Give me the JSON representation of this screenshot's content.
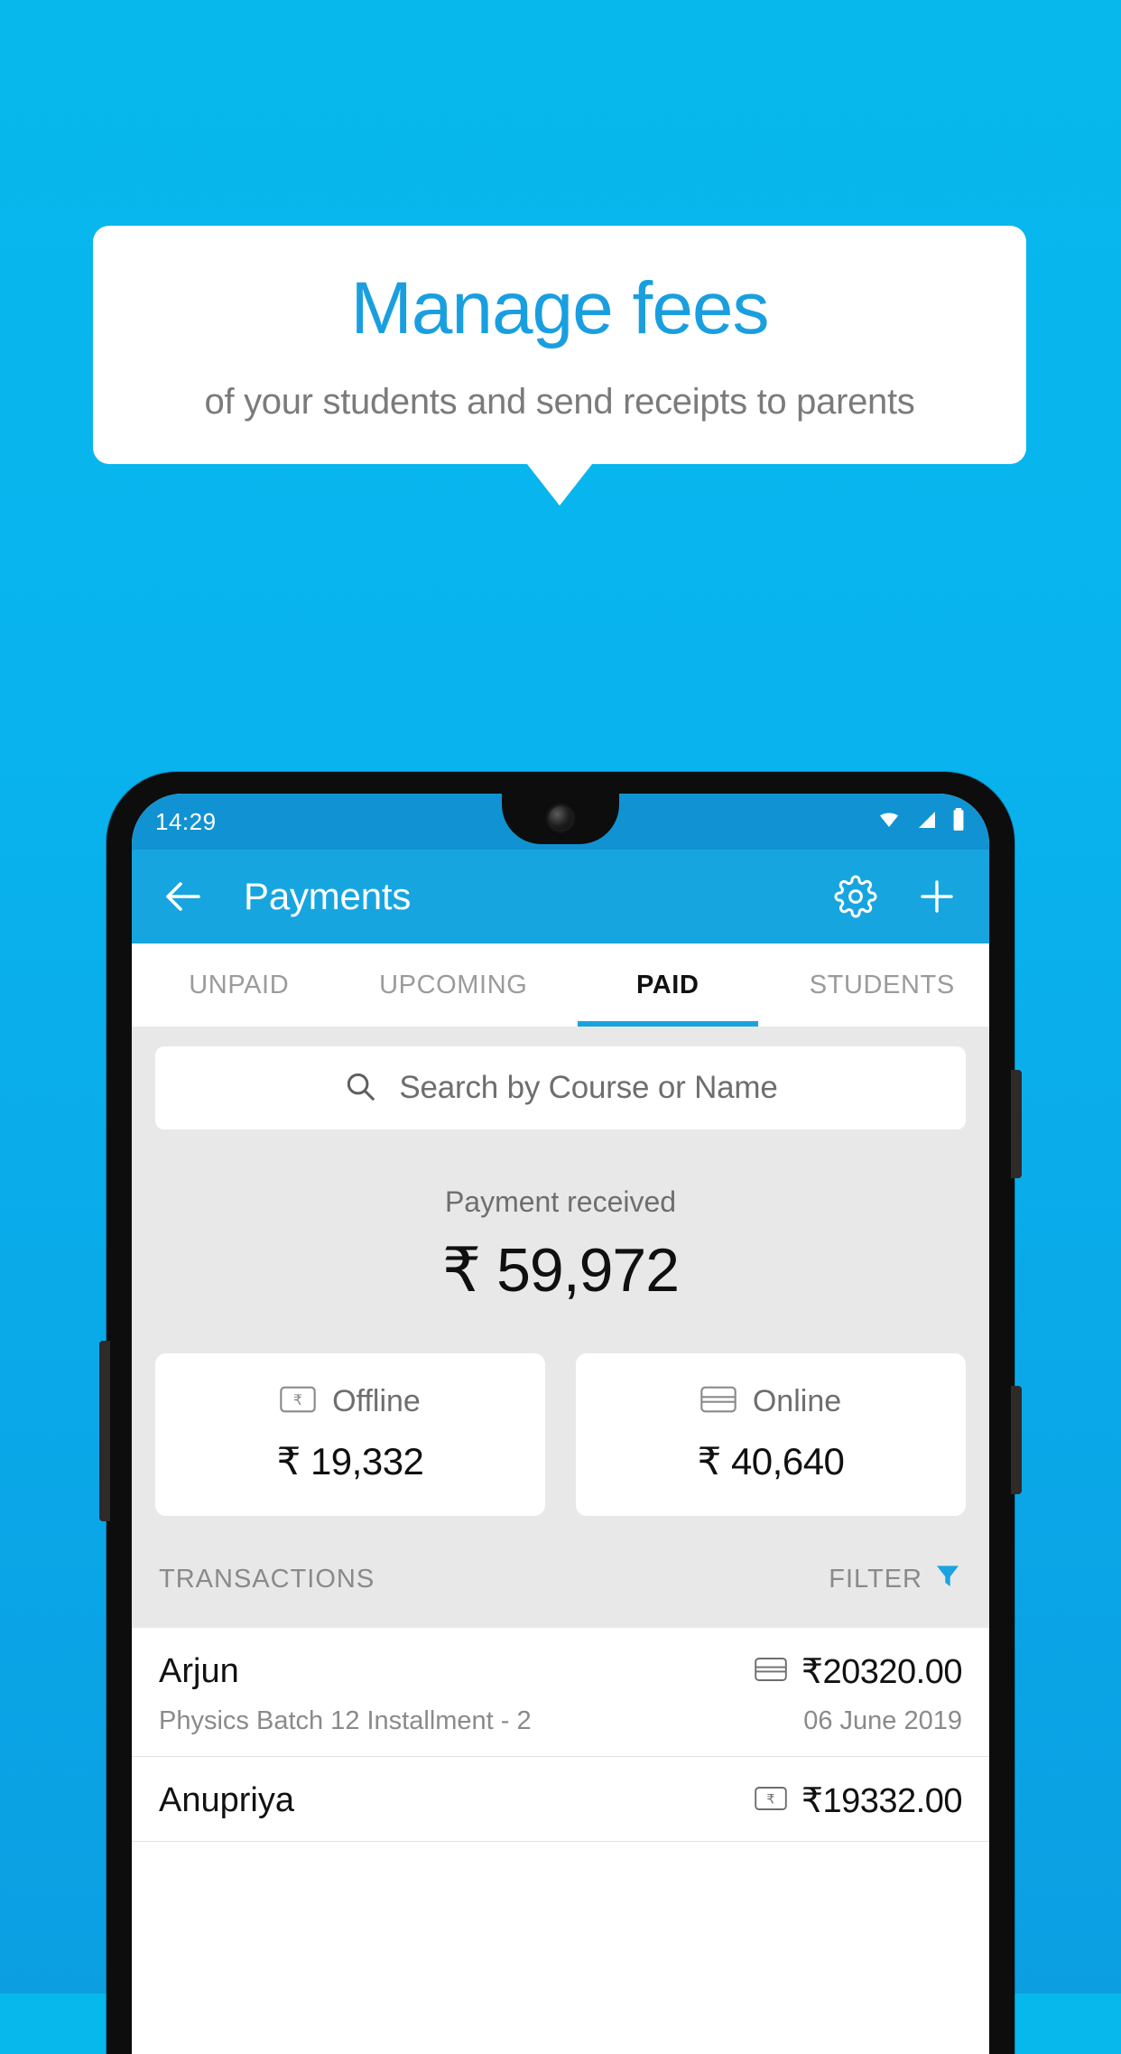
{
  "promo": {
    "title": "Manage fees",
    "subtitle": "of your students and send receipts to parents",
    "title_color": "#199fe0",
    "subtitle_color": "#7b7b7b"
  },
  "background": {
    "top_color": "#06b8ec",
    "bottom_color": "#0b9fe2"
  },
  "phone": {
    "statusbar": {
      "time": "14:29",
      "icons": [
        "wifi-icon",
        "signal-icon",
        "battery-icon"
      ],
      "background": "#1193d3"
    },
    "appbar": {
      "title": "Payments",
      "back_icon": "back-arrow-icon",
      "settings_icon": "gear-icon",
      "add_icon": "plus-icon",
      "background": "#17a5e0"
    },
    "tabs": [
      {
        "label": "UNPAID",
        "active": false
      },
      {
        "label": "UPCOMING",
        "active": false
      },
      {
        "label": "PAID",
        "active": true
      },
      {
        "label": "STUDENTS",
        "active": false
      }
    ],
    "tab_indicator_color": "#19a3de",
    "search": {
      "placeholder": "Search by Course or Name",
      "icon": "search-icon"
    },
    "summary": {
      "label": "Payment received",
      "amount": "₹ 59,972"
    },
    "breakdown": [
      {
        "label": "Offline",
        "amount": "₹ 19,332",
        "icon": "cash-note-icon"
      },
      {
        "label": "Online",
        "amount": "₹ 40,640",
        "icon": "credit-card-icon"
      }
    ],
    "transactions_header": {
      "title": "TRANSACTIONS",
      "filter_label": "FILTER",
      "filter_icon": "funnel-icon",
      "filter_icon_color": "#1ba3e0"
    },
    "transactions": [
      {
        "name": "Arjun",
        "amount": "₹20320.00",
        "method_icon": "credit-card-icon",
        "description": "Physics Batch 12 Installment - 2",
        "date": "06 June 2019"
      },
      {
        "name": "Anupriya",
        "amount": "₹19332.00",
        "method_icon": "cash-note-icon",
        "description": "",
        "date": ""
      }
    ]
  }
}
